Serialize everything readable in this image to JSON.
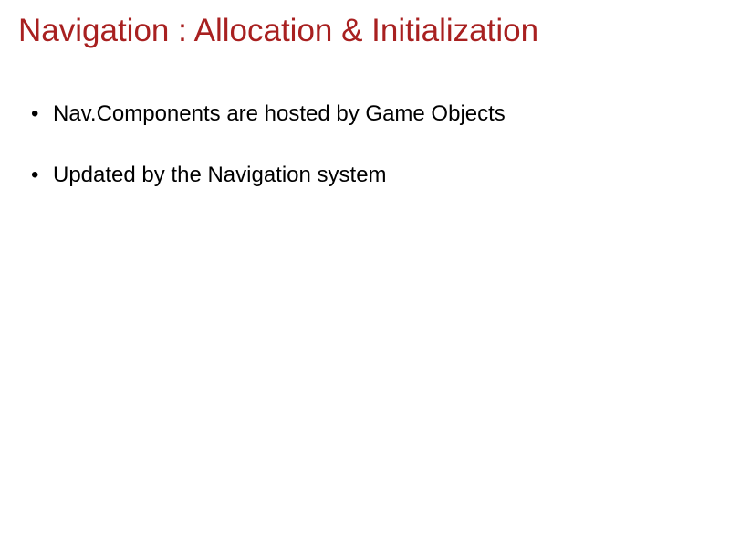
{
  "slide": {
    "title": "Navigation : Allocation & Initialization",
    "bullets": [
      "Nav.Components are hosted by Game Objects",
      "Updated by the Navigation system"
    ]
  }
}
